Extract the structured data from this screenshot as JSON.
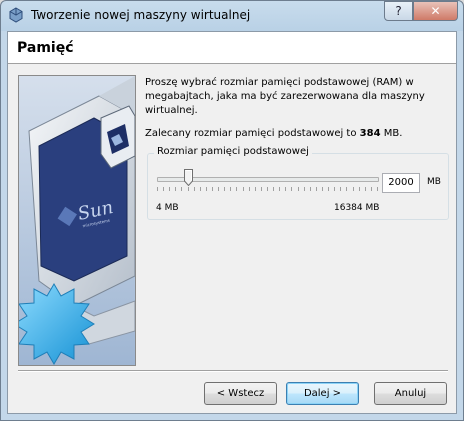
{
  "window": {
    "title": "Tworzenie nowej maszyny wirtualnej",
    "help_label": "?",
    "close_label": "✕"
  },
  "page": {
    "title": "Pamięć",
    "description": "Proszę wybrać rozmiar pamięci podstawowej (RAM) w megabajtach, jaka ma być zarezerwowana dla maszyny wirtualnej.",
    "recommend_prefix": "Zalecany rozmiar pamięci podstawowej to ",
    "recommend_value": "384",
    "recommend_suffix": " MB."
  },
  "memory": {
    "group_label": "Rozmiar pamięci podstawowej",
    "value": "2000",
    "unit": "MB",
    "min_label": "4 MB",
    "max_label": "16384 MB",
    "slider_fraction": 0.122
  },
  "buttons": {
    "back": "< Wstecz",
    "next": "Dalej >",
    "cancel": "Anuluj"
  },
  "image": {
    "brand_text": "Sun",
    "brand_sub": "microsystems"
  },
  "colors": {
    "accent": "#3c7fb1",
    "monitor_blue": "#2a3f7e",
    "star": "#48b8f0"
  }
}
